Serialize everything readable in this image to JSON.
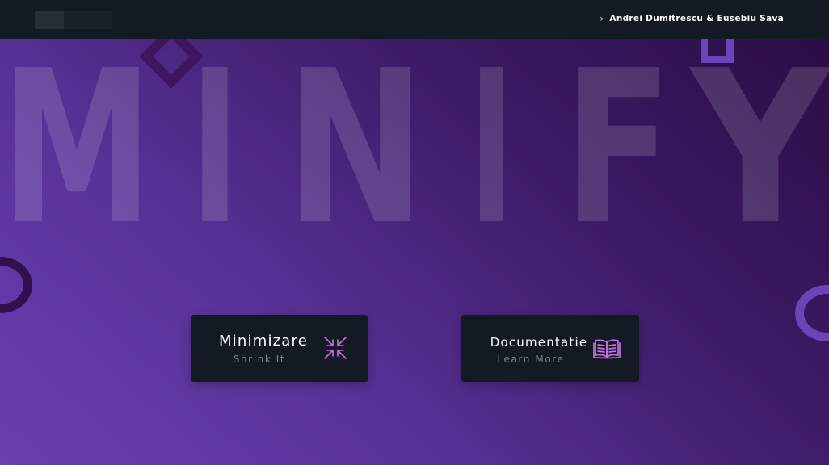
{
  "header": {
    "authors": "Andrei Dumitrescu & Eusebiu Sava",
    "chevron_glyph": "›"
  },
  "hero": {
    "letters": [
      "M",
      "I",
      "N",
      "I",
      "F",
      "Y"
    ]
  },
  "cards": {
    "minimize": {
      "title": "Minimizare",
      "subtitle": "Shrink It",
      "icon": "shrink-arrows-icon"
    },
    "docs": {
      "title": "Documentatie",
      "subtitle": "Learn More",
      "icon": "open-book-icon"
    }
  },
  "colors": {
    "navbar": "#141a24",
    "card": "#141a24",
    "accent": "#c86ee6",
    "shape_light": "#6b44b8",
    "shape_dark": "#3d1560"
  }
}
